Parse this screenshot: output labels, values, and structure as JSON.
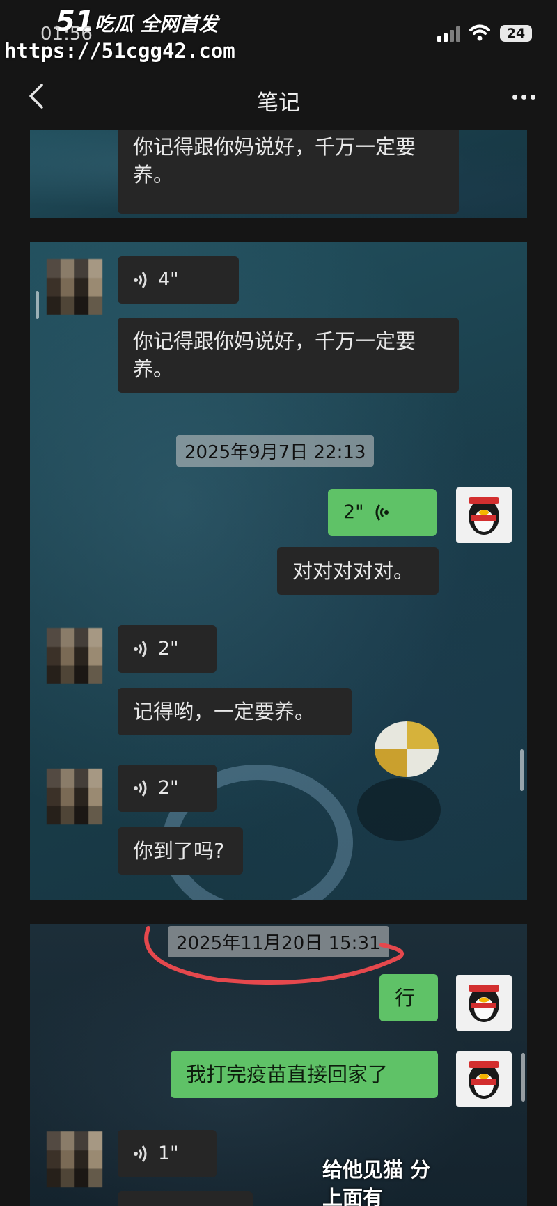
{
  "watermark": {
    "logo_num": "51",
    "logo_text": "吃瓜 全网首发",
    "url": "https://51cgg42.com"
  },
  "status": {
    "time": "01:56",
    "battery": "24"
  },
  "nav": {
    "title": "笔记"
  },
  "panel1": {
    "msg": "你记得跟你妈说好，千万一定要养。"
  },
  "panel2": {
    "voice1": "4\"",
    "msg1": "你记得跟你妈说好，千万一定要养。",
    "timestamp": "2025年9月7日 22:13",
    "voice_me": "2\"",
    "msg_me": "对对对对对。",
    "voice2": "2\"",
    "msg2": "记得哟，一定要养。",
    "voice3": "2\"",
    "msg3": "你到了吗?"
  },
  "panel3": {
    "timestamp": "2025年11月20日 15:31",
    "msg_me1": "行",
    "msg_me2": "我打完疫苗直接回家了",
    "voice1": "1\"",
    "overlay_line1": "给他见猫 分",
    "overlay_line2": "上面有"
  },
  "colors": {
    "green_bubble": "#5fc267",
    "gray_bubble": "#262626",
    "annotation_red": "#e5484d"
  }
}
